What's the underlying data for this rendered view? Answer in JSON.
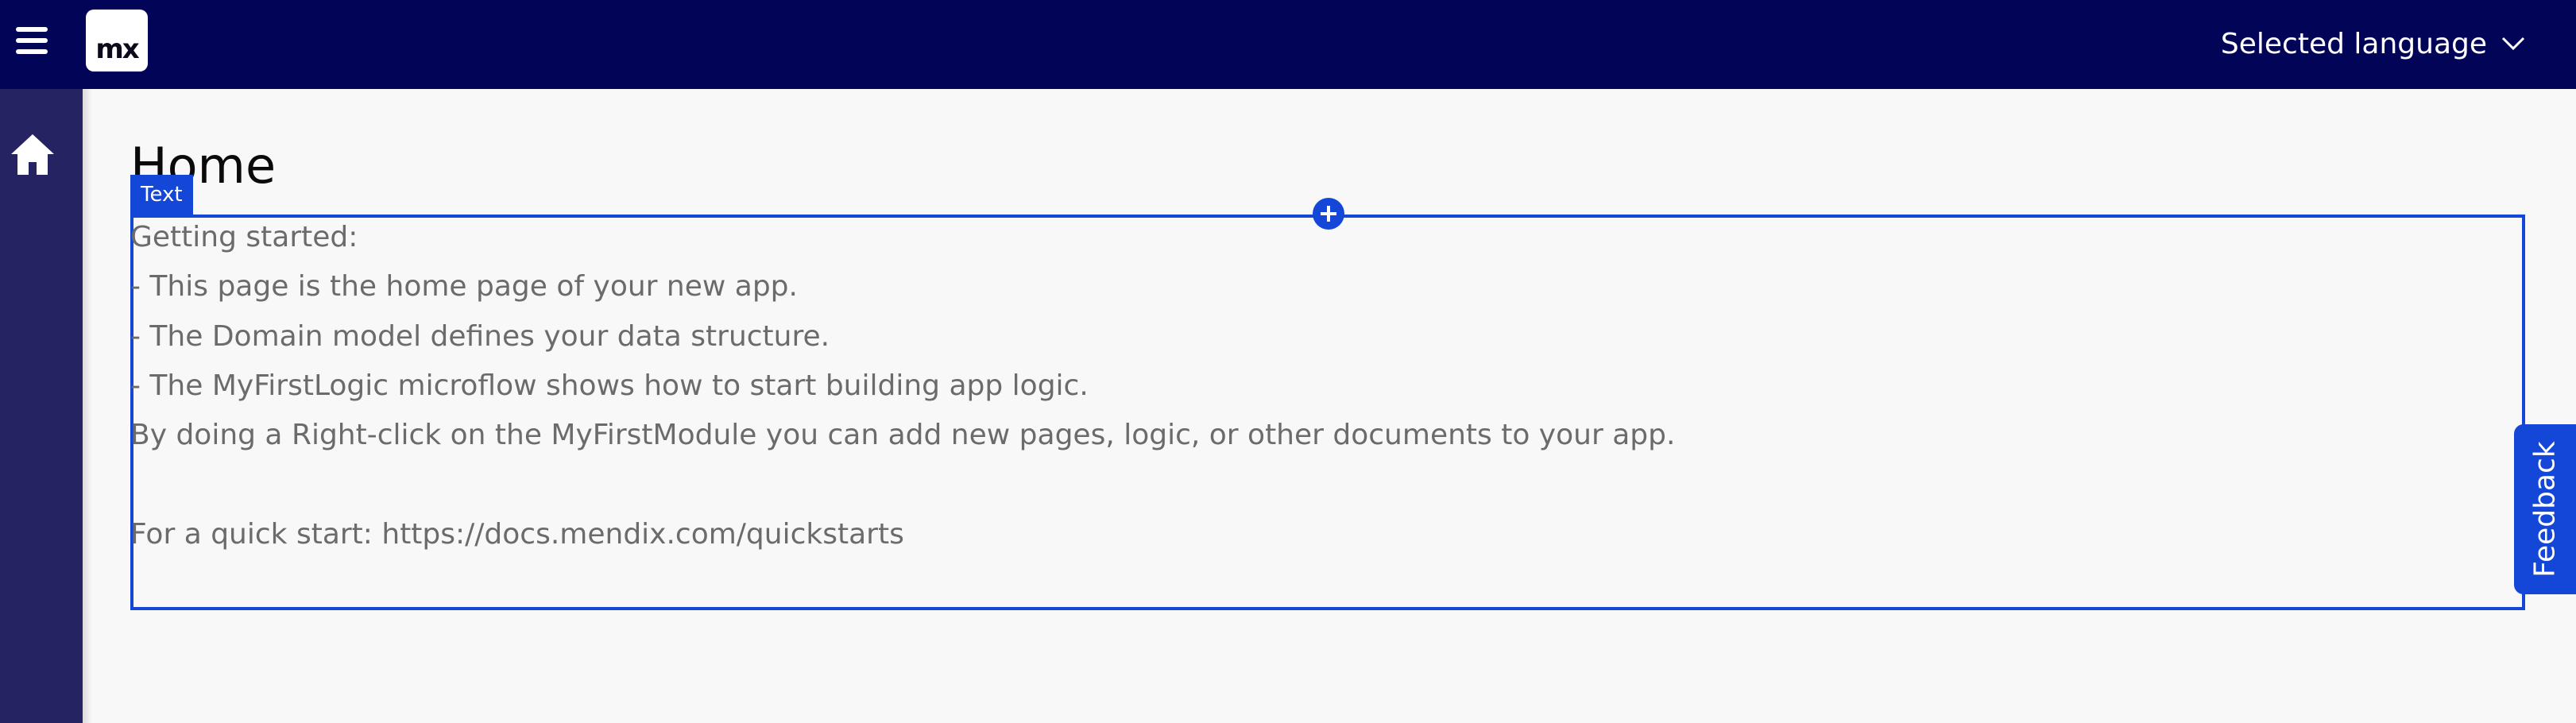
{
  "header": {
    "logo_text": "mx",
    "language_label": "Selected language"
  },
  "page": {
    "title": "Home"
  },
  "selection": {
    "tag_label": "Text"
  },
  "content": {
    "lines": [
      "Getting started:",
      "- This page is the home page of your new app.",
      "- The Domain model defines your data structure.",
      "- The MyFirstLogic microflow shows how to start building app logic.",
      "By doing a Right-click on the MyFirstModule you can add new pages, logic, or other documents to your app.",
      "For a quick start: https://docs.mendix.com/quickstarts"
    ]
  },
  "feedback": {
    "label": "Feedback"
  },
  "colors": {
    "topbar": "#020557",
    "sidebar": "#252361",
    "accent": "#1446d8"
  }
}
